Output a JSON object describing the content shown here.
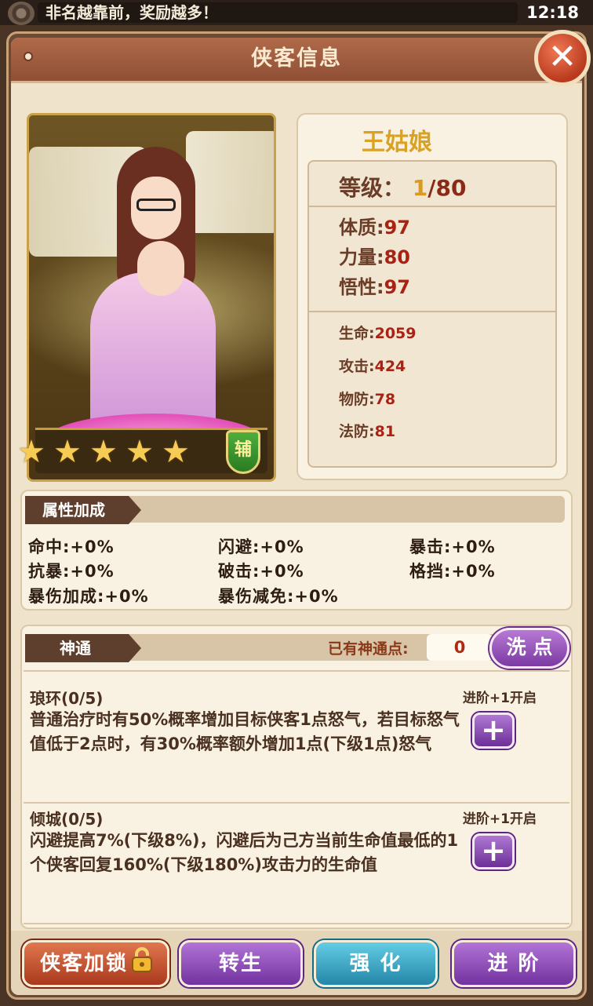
{
  "status_bar": {
    "ticker": "非名越靠前，奖励越多！",
    "clock": "12:18"
  },
  "header": {
    "title": "侠客信息",
    "close_glyph": "✕"
  },
  "hero": {
    "name": "王姑娘",
    "stars": 5,
    "role_badge": "辅",
    "level_label": "等级：",
    "level_current": "1",
    "level_sep": "/",
    "level_max": "80",
    "base_stats": [
      {
        "label": "体质:",
        "value": "97"
      },
      {
        "label": "力量:",
        "value": "80"
      },
      {
        "label": "悟性:",
        "value": "97"
      }
    ],
    "combat_stats": [
      {
        "label": "生命:",
        "value": "2059"
      },
      {
        "label": "攻击:",
        "value": "424"
      },
      {
        "label": "物防:",
        "value": "78"
      },
      {
        "label": "法防:",
        "value": "81"
      }
    ]
  },
  "attributes": {
    "section_title": "属性加成",
    "items": [
      "命中:+0%",
      "闪避:+0%",
      "暴击:+0%",
      "抗暴:+0%",
      "破击:+0%",
      "格挡:+0%",
      "暴伤加成:+0%",
      "暴伤减免:+0%"
    ]
  },
  "divine": {
    "section_title": "神通",
    "points_label": "已有神通点:",
    "points_value": "0",
    "reset_button": "洗 点",
    "skills": [
      {
        "title": "琅环(0/5)",
        "unlock": "进阶+1开启",
        "desc": "普通治疗时有50%概率增加目标侠客1点怒气，若目标怒气值低于2点时，有30%概率额外增加1点(下级1点)怒气"
      },
      {
        "title": "倾城(0/5)",
        "unlock": "进阶+1开启",
        "desc": "闪避提高7%(下级8%)，闪避后为己方当前生命值最低的1个侠客回复160%(下级180%)攻击力的生命值"
      }
    ]
  },
  "actions": {
    "lock": "侠客加锁",
    "rebirth": "转生",
    "enhance": "强 化",
    "advance": "进 阶"
  },
  "colors": {
    "frame": "#6b4a36",
    "panel": "#f9f2e2",
    "accent_purple": "#7a3aa2",
    "accent_cyan": "#2486a8",
    "accent_orange": "#a9391c",
    "value_red": "#a92214",
    "name_gold": "#d9a224"
  }
}
